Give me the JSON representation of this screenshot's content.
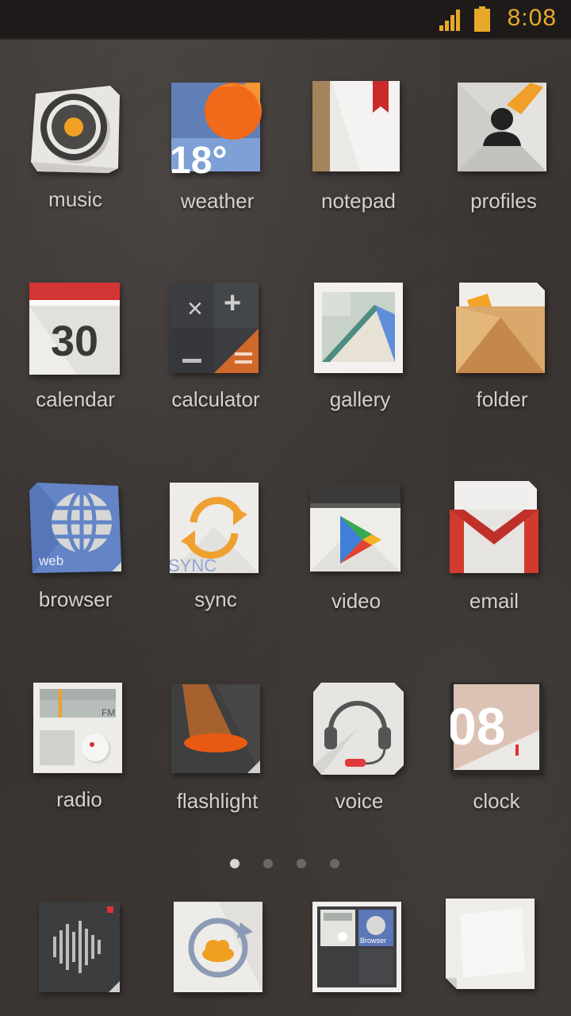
{
  "status_bar": {
    "time": "8:08"
  },
  "apps": [
    {
      "label": "music",
      "icon": "music-icon"
    },
    {
      "label": "weather",
      "icon": "weather-icon",
      "temp": "18°"
    },
    {
      "label": "notepad",
      "icon": "notepad-icon"
    },
    {
      "label": "profiles",
      "icon": "profiles-icon"
    },
    {
      "label": "calendar",
      "icon": "calendar-icon",
      "day": "30"
    },
    {
      "label": "calculator",
      "icon": "calculator-icon"
    },
    {
      "label": "gallery",
      "icon": "gallery-icon"
    },
    {
      "label": "folder",
      "icon": "folder-icon"
    },
    {
      "label": "browser",
      "icon": "globe-icon",
      "sub": "web"
    },
    {
      "label": "sync",
      "icon": "sync-icon",
      "sub": "SYNC"
    },
    {
      "label": "video",
      "icon": "play-icon"
    },
    {
      "label": "email",
      "icon": "gmail-icon"
    },
    {
      "label": "radio",
      "icon": "radio-icon",
      "sub": "FM"
    },
    {
      "label": "flashlight",
      "icon": "flashlight-icon"
    },
    {
      "label": "voice",
      "icon": "headset-icon"
    },
    {
      "label": "clock",
      "icon": "clock-icon",
      "num": "08"
    }
  ],
  "page_indicator": {
    "count": 4,
    "active": 1
  },
  "dock": [
    {
      "icon": "soundwave-icon"
    },
    {
      "icon": "cloud-backup-icon"
    },
    {
      "icon": "widget-folder-icon",
      "sub": "Browser"
    },
    {
      "icon": "blank-app-icon"
    }
  ],
  "colors": {
    "accent": "#e8a92a",
    "label": "#d5d1cd",
    "background": "#3c3734"
  }
}
